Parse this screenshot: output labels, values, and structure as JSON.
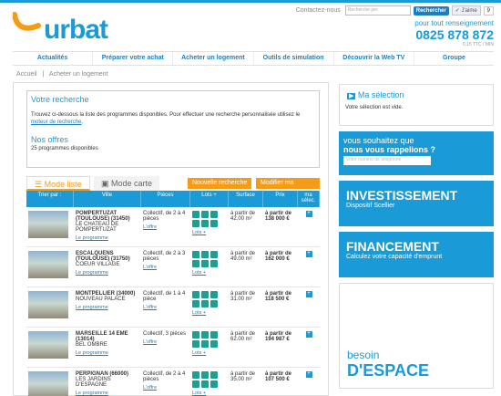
{
  "header": {
    "logo_text": "urbat",
    "contact_link": "Contactez-nous",
    "search_placeholder": "Recherche per",
    "search_button": "Rechercher",
    "like_label": "J'aime",
    "like_count": "9",
    "phone_label": "pour tout renseignement",
    "phone_number": "0825 878 872",
    "phone_tarif": "0,15 TTC / MIN"
  },
  "nav": [
    "Actualités",
    "Préparer votre achat",
    "Acheter un logement",
    "Outils de simulation",
    "Découvrir la Web TV",
    "Groupe"
  ],
  "breadcrumb": [
    "Accueil",
    "Acheter un logement"
  ],
  "search": {
    "title": "Votre recherche",
    "text1": "Trouvez ci-dessous la liste des programmes disponibles. Pour effectuer une recherche personnalisée utilisez le ",
    "link": "moteur de recherche",
    "text2": ".",
    "offres_title": "Nos offres",
    "offres_count": "25 programmes disponibles"
  },
  "tabs": {
    "list": "Mode liste",
    "map": "Mode carte",
    "new_search": "Nouvelle recherche",
    "modify_search": "Modifier ma recherche"
  },
  "table": {
    "sort_label": "Trier par :",
    "columns": [
      "Ville",
      "Pièces",
      "Lots +",
      "Surface",
      "Prix",
      "ma sélec."
    ]
  },
  "programs": [
    {
      "city": "POMPERTUZAT (TOULOUSE) (31450)",
      "name": "LE CHATEAU DE POMPERTUZAT",
      "rooms": "Collectif, de 2 à 4 pièces",
      "surface": "à partir de 42.00 m²",
      "price": "à partir de 138 000 €",
      "link": "Le programme",
      "offer": "L'offre",
      "lots": "Lots +"
    },
    {
      "city": "ESCALQUENS (TOULOUSE) (31750)",
      "name": "COEUR VILLAGE",
      "rooms": "Collectif, de 2 à 3 pièces",
      "surface": "à partir de 49.00 m²",
      "price": "à partir de 162 000 €",
      "link": "Le programme",
      "offer": "L'offre",
      "lots": "Lots +"
    },
    {
      "city": "MONTPELLIER (34000)",
      "name": "NOUVEAU PALACE",
      "rooms": "Collectif, de 1 à 4 pièce",
      "surface": "à partir de 31.00 m²",
      "price": "à partir de 118 500 €",
      "link": "Le programme",
      "offer": "L'offre",
      "lots": "Lots +"
    },
    {
      "city": "MARSEILLE 14 EME (13014)",
      "name": "BEL OMBRE",
      "rooms": "Collectif, 3 pièces",
      "surface": "à partir de 62.00 m²",
      "price": "à partir de 194 987 €",
      "link": "Le programme",
      "offer": "L'offre",
      "lots": "Lots +"
    },
    {
      "city": "PERPIGNAN (66000)",
      "name": "LES JARDINS D'ESPAGNE",
      "rooms": "Collectif, de 2 à 4 pièces",
      "surface": "à partir de 35.00 m²",
      "price": "à partir de 107 500 €",
      "link": "Le programme",
      "offer": "L'offre",
      "lots": "Lots +"
    }
  ],
  "sidebar": {
    "selection_title": "Ma sélection",
    "selection_text": "Votre sélection est vide.",
    "call_title": "vous souhaitez que",
    "call_sub": "nous vous rappelions ?",
    "call_placeholder": "Votre numéro de téléphone",
    "promo1_title": "INVESTISSEMENT",
    "promo1_sub": "Dispositif Scellier",
    "promo2_title": "FINANCEMENT",
    "promo2_sub": "Calculez votre capacité d'emprunt",
    "plan_text1": "besoin",
    "plan_text2": "D'ESPACE"
  },
  "colors": {
    "brand": "#1a9ad6",
    "accent": "#f49b18"
  }
}
